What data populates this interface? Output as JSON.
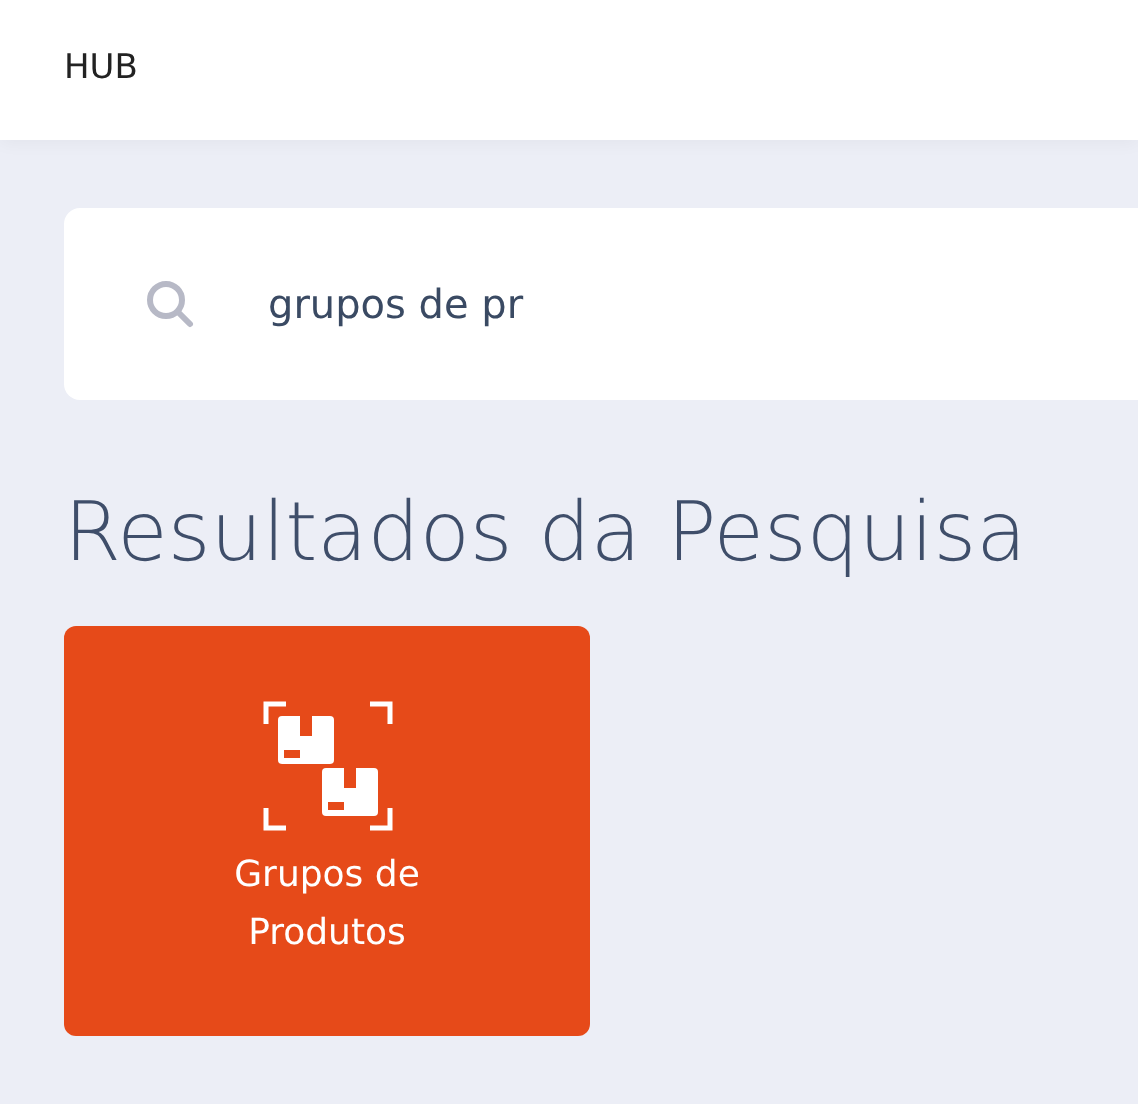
{
  "header": {
    "title": "HUB"
  },
  "search": {
    "value": "grupos de pr"
  },
  "results": {
    "title": "Resultados da Pesquisa",
    "items": [
      {
        "label": "Grupos de Produtos"
      }
    ]
  }
}
